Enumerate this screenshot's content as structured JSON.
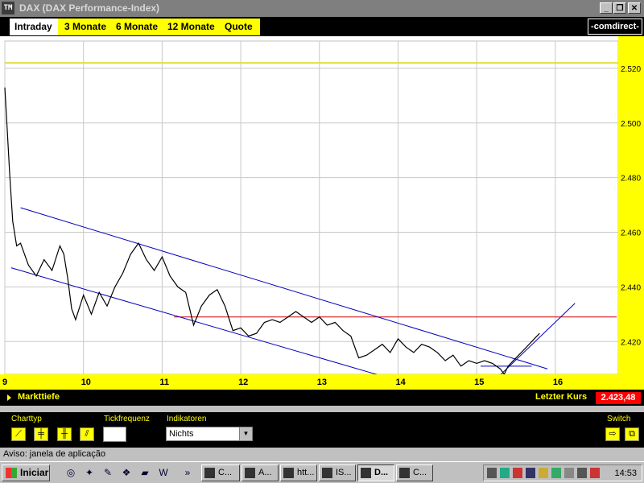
{
  "window": {
    "title": "DAX (DAX Performance-Index)",
    "app_icon": "TM",
    "controls": [
      "minimize",
      "restore",
      "close"
    ]
  },
  "tabs": [
    {
      "label": "Intraday",
      "active": true
    },
    {
      "label": "3 Monate"
    },
    {
      "label": "6 Monate"
    },
    {
      "label": "12 Monate"
    },
    {
      "label": "Quote"
    }
  ],
  "brand": "-comdirect-",
  "chart_data": {
    "type": "line",
    "x_ticks": [
      "9",
      "10",
      "11",
      "12",
      "13",
      "14",
      "15",
      "16"
    ],
    "y_ticks": [
      "2.520",
      "2.500",
      "2.480",
      "2.460",
      "2.440",
      "2.420"
    ],
    "ylim": [
      2408,
      2530
    ],
    "xlim": [
      9,
      16.8
    ],
    "grid": true,
    "reference_line_yellow": 2522,
    "reference_line_red": 2429,
    "series": [
      {
        "points": [
          [
            9.0,
            2513
          ],
          [
            9.03,
            2498
          ],
          [
            9.06,
            2482
          ],
          [
            9.1,
            2464
          ],
          [
            9.15,
            2455
          ],
          [
            9.2,
            2456
          ],
          [
            9.3,
            2448
          ],
          [
            9.4,
            2444
          ],
          [
            9.5,
            2450
          ],
          [
            9.6,
            2446
          ],
          [
            9.7,
            2455
          ],
          [
            9.75,
            2452
          ],
          [
            9.8,
            2443
          ],
          [
            9.85,
            2432
          ],
          [
            9.9,
            2428
          ],
          [
            10.0,
            2437
          ],
          [
            10.1,
            2430
          ],
          [
            10.2,
            2438
          ],
          [
            10.3,
            2433
          ],
          [
            10.4,
            2440
          ],
          [
            10.5,
            2445
          ],
          [
            10.6,
            2452
          ],
          [
            10.7,
            2456
          ],
          [
            10.8,
            2450
          ],
          [
            10.9,
            2446
          ],
          [
            11.0,
            2451
          ],
          [
            11.1,
            2444
          ],
          [
            11.2,
            2440
          ],
          [
            11.3,
            2438
          ],
          [
            11.4,
            2426
          ],
          [
            11.5,
            2433
          ],
          [
            11.6,
            2437
          ],
          [
            11.7,
            2439
          ],
          [
            11.8,
            2433
          ],
          [
            11.9,
            2424
          ],
          [
            12.0,
            2425
          ],
          [
            12.1,
            2422
          ],
          [
            12.2,
            2423
          ],
          [
            12.3,
            2427
          ],
          [
            12.4,
            2428
          ],
          [
            12.5,
            2427
          ],
          [
            12.6,
            2429
          ],
          [
            12.7,
            2431
          ],
          [
            12.8,
            2429
          ],
          [
            12.9,
            2427
          ],
          [
            13.0,
            2429
          ],
          [
            13.1,
            2426
          ],
          [
            13.2,
            2427
          ],
          [
            13.3,
            2424
          ],
          [
            13.4,
            2422
          ],
          [
            13.5,
            2414
          ],
          [
            13.6,
            2415
          ],
          [
            13.7,
            2417
          ],
          [
            13.8,
            2419
          ],
          [
            13.9,
            2416
          ],
          [
            14.0,
            2421
          ],
          [
            14.1,
            2418
          ],
          [
            14.2,
            2416
          ],
          [
            14.3,
            2419
          ],
          [
            14.4,
            2418
          ],
          [
            14.5,
            2416
          ],
          [
            14.6,
            2413
          ],
          [
            14.7,
            2415
          ],
          [
            14.8,
            2411
          ],
          [
            14.9,
            2413
          ],
          [
            15.0,
            2412
          ],
          [
            15.1,
            2413
          ],
          [
            15.2,
            2412
          ],
          [
            15.3,
            2410
          ],
          [
            15.35,
            2408
          ],
          [
            15.4,
            2411
          ],
          [
            15.5,
            2414
          ],
          [
            15.6,
            2417
          ],
          [
            15.7,
            2420
          ],
          [
            15.8,
            2423
          ]
        ]
      }
    ],
    "trendlines": [
      {
        "color": "#0000c0",
        "points": [
          [
            9.2,
            2469
          ],
          [
            15.9,
            2410
          ]
        ]
      },
      {
        "color": "#0000c0",
        "points": [
          [
            9.08,
            2447
          ],
          [
            14.08,
            2405
          ]
        ]
      },
      {
        "color": "#0000c0",
        "points": [
          [
            15.05,
            2411
          ],
          [
            15.7,
            2411
          ]
        ]
      },
      {
        "color": "#0000c0",
        "points": [
          [
            15.2,
            2405
          ],
          [
            16.25,
            2434
          ]
        ]
      }
    ]
  },
  "footer": {
    "markttiefe": "Markttiefe",
    "letzter_kurs_label": "Letzter Kurs",
    "letzter_kurs_value": "2.423,48"
  },
  "controls": {
    "charttyp_label": "Charttyp",
    "tickfrequenz_label": "Tickfrequenz",
    "indikatoren_label": "Indikatoren",
    "indikatoren_value": "Nichts",
    "switch_label": "Switch",
    "chart_type_icons": [
      "line-chart-icon",
      "candle-chart-icon",
      "bar-chart-icon",
      "ohlc-chart-icon"
    ]
  },
  "status_text": "Aviso: janela de aplicação",
  "taskbar": {
    "start_label": "Iniciar",
    "tasks": [
      {
        "label": "C..."
      },
      {
        "label": "A..."
      },
      {
        "label": "htt..."
      },
      {
        "label": "IS..."
      },
      {
        "label": "D...",
        "active": true
      },
      {
        "label": "C..."
      }
    ],
    "clock": "14:53"
  }
}
